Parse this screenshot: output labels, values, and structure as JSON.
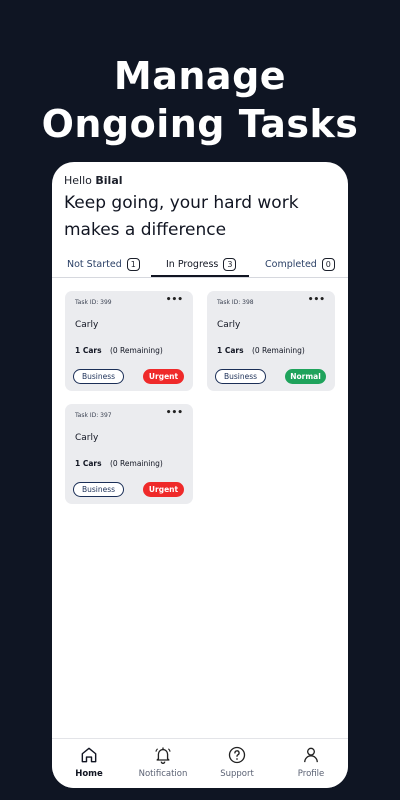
{
  "promo": {
    "headline_line1": "Manage",
    "headline_line2": "Ongoing Tasks"
  },
  "greeting": {
    "prefix": "Hello",
    "name": "Bilal"
  },
  "motto": "Keep going, your hard work makes a difference",
  "tabs": [
    {
      "label": "Not Started",
      "count": "1"
    },
    {
      "label": "In Progress",
      "count": "3",
      "active": true
    },
    {
      "label": "Completed",
      "count": "0"
    }
  ],
  "tasks": [
    {
      "task_id": "Task ID: 399",
      "customer": "Carly",
      "cars": "1 Cars",
      "remaining": "(0 Remaining)",
      "category": "Business",
      "priority": "Urgent",
      "priority_color": "#ef2a2a"
    },
    {
      "task_id": "Task ID: 398",
      "customer": "Carly",
      "cars": "1 Cars",
      "remaining": "(0 Remaining)",
      "category": "Business",
      "priority": "Normal",
      "priority_color": "#1fa35c"
    },
    {
      "task_id": "Task ID: 397",
      "customer": "Carly",
      "cars": "1 Cars",
      "remaining": "(0 Remaining)",
      "category": "Business",
      "priority": "Urgent",
      "priority_color": "#ef2a2a"
    }
  ],
  "menu_glyph": "•••",
  "nav": [
    {
      "label": "Home",
      "icon": "home-icon",
      "active": true
    },
    {
      "label": "Notification",
      "icon": "bell-icon"
    },
    {
      "label": "Support",
      "icon": "question-icon"
    },
    {
      "label": "Profile",
      "icon": "user-icon"
    }
  ],
  "colors": {
    "background": "#0f1523",
    "urgent": "#ef2a2a",
    "normal": "#1fa35c",
    "chip_border": "#1b2f57"
  }
}
